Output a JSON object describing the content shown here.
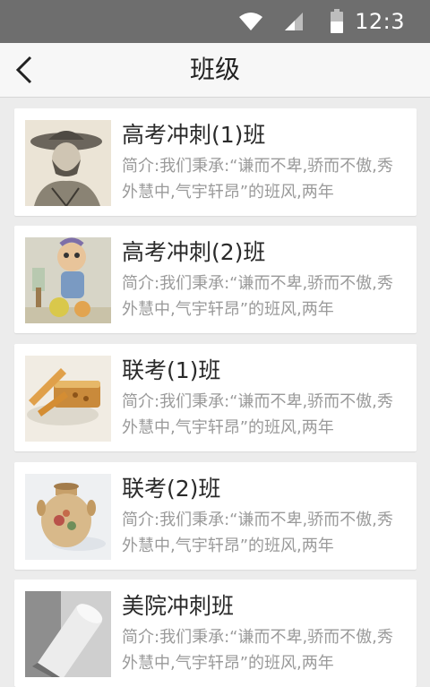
{
  "status_bar": {
    "time": "12:3"
  },
  "header": {
    "title": "班级"
  },
  "classes": [
    {
      "title": "高考冲刺(1)班",
      "desc": "简介:我们秉承:“谦而不卑,骄而不傲,秀外慧中,气宇轩昂”的班风,两年"
    },
    {
      "title": "高考冲刺(2)班",
      "desc": "简介:我们秉承:“谦而不卑,骄而不傲,秀外慧中,气宇轩昂”的班风,两年"
    },
    {
      "title": "联考(1)班",
      "desc": "简介:我们秉承:“谦而不卑,骄而不傲,秀外慧中,气宇轩昂”的班风,两年"
    },
    {
      "title": "联考(2)班",
      "desc": "简介:我们秉承:“谦而不卑,骄而不傲,秀外慧中,气宇轩昂”的班风,两年"
    },
    {
      "title": "美院冲刺班",
      "desc": "简介:我们秉承:“谦而不卑,骄而不傲,秀外慧中,气宇轩昂”的班风,两年"
    }
  ]
}
